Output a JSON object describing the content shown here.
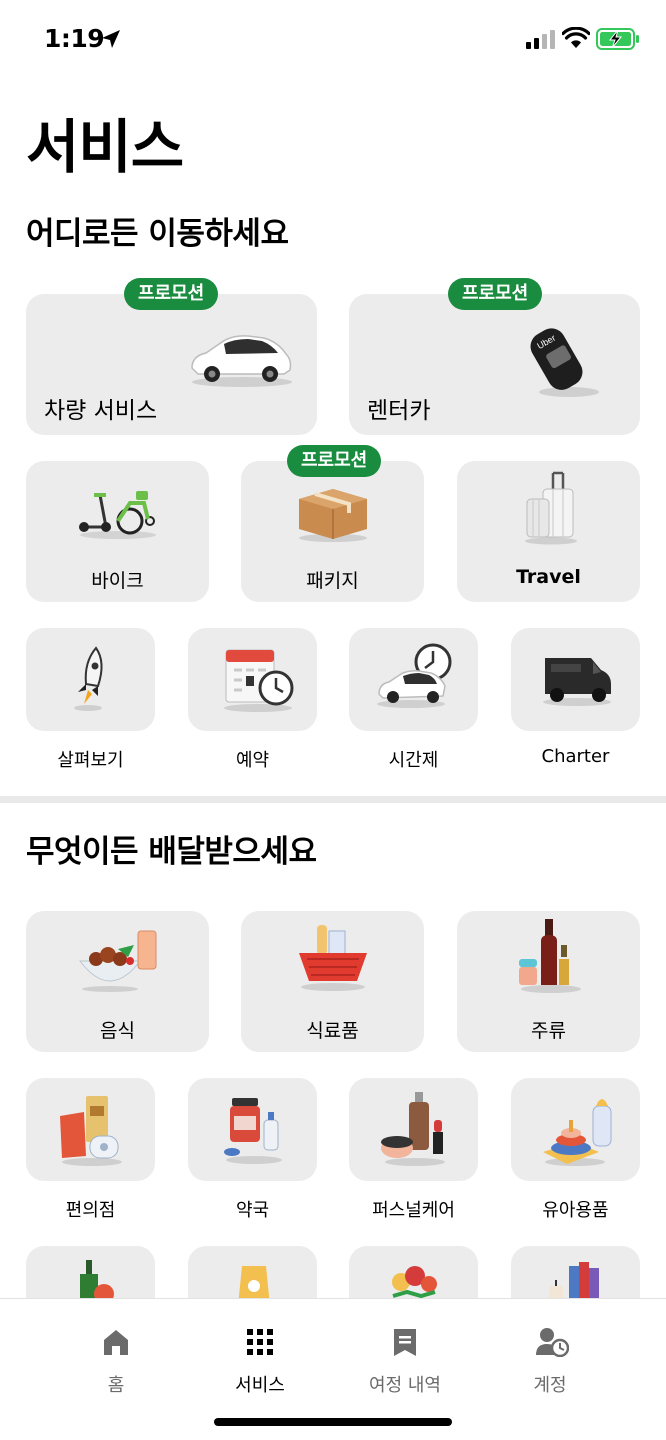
{
  "status_bar": {
    "time": "1:19"
  },
  "page_title": "서비스",
  "ride_section": {
    "title": "어디로든 이동하세요",
    "promo_label": "프로모션",
    "large_tiles": [
      {
        "label": "차량 서비스",
        "icon": "car-icon",
        "promo": true
      },
      {
        "label": "렌터카",
        "icon": "car-key-icon",
        "promo": true
      }
    ],
    "medium_tiles": [
      {
        "label": "바이크",
        "icon": "bike-scooter-icon",
        "promo": false
      },
      {
        "label": "패키지",
        "icon": "package-icon",
        "promo": true
      },
      {
        "label": "Travel",
        "icon": "luggage-icon",
        "promo": false
      }
    ],
    "small_tiles": [
      {
        "label": "살펴보기",
        "icon": "rocket-icon"
      },
      {
        "label": "예약",
        "icon": "calendar-clock-icon"
      },
      {
        "label": "시간제",
        "icon": "car-clock-icon"
      },
      {
        "label": "Charter",
        "icon": "van-icon"
      }
    ]
  },
  "delivery_section": {
    "title": "무엇이든 배달받으세요",
    "medium_tiles": [
      {
        "label": "음식",
        "icon": "food-bowl-icon"
      },
      {
        "label": "식료품",
        "icon": "grocery-basket-icon"
      },
      {
        "label": "주류",
        "icon": "liquor-bottles-icon"
      }
    ],
    "small_tiles": [
      {
        "label": "편의점",
        "icon": "convenience-store-icon"
      },
      {
        "label": "약국",
        "icon": "pharmacy-icon"
      },
      {
        "label": "퍼스널케어",
        "icon": "personal-care-icon"
      },
      {
        "label": "유아용품",
        "icon": "baby-products-icon"
      }
    ]
  },
  "bottom_nav": [
    {
      "label": "홈",
      "icon": "home-icon",
      "active": false
    },
    {
      "label": "서비스",
      "icon": "grid-icon",
      "active": true
    },
    {
      "label": "여정 내역",
      "icon": "receipt-icon",
      "active": false
    },
    {
      "label": "계정",
      "icon": "account-icon",
      "active": false
    }
  ],
  "colors": {
    "promo": "#1a8c3f",
    "tile_bg": "#ececec",
    "battery": "#34c759"
  }
}
